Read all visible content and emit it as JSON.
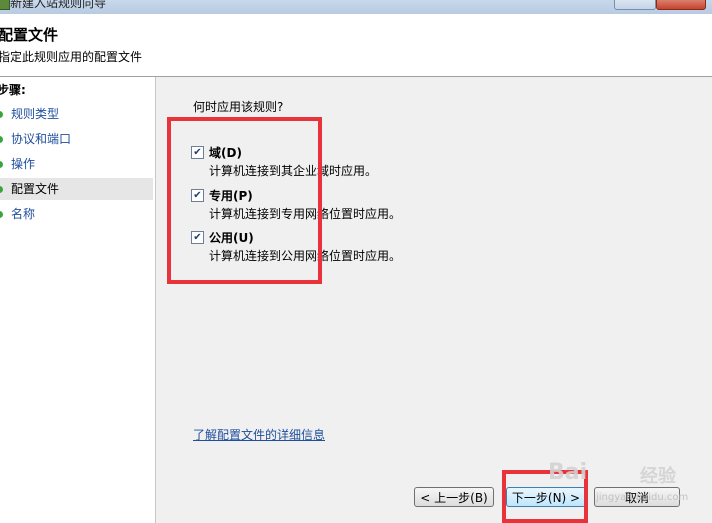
{
  "window": {
    "title": "新建入站规则向导"
  },
  "header": {
    "title": "配置文件",
    "subtitle": "指定此规则应用的配置文件"
  },
  "steps": {
    "title": "步骤:",
    "items": [
      {
        "label": "规则类型"
      },
      {
        "label": "协议和端口"
      },
      {
        "label": "操作"
      },
      {
        "label": "配置文件"
      },
      {
        "label": "名称"
      }
    ]
  },
  "main": {
    "question": "何时应用该规则?",
    "options": [
      {
        "label": "域(D)",
        "description": "计算机连接到其企业域时应用。",
        "checked": true
      },
      {
        "label": "专用(P)",
        "description": "计算机连接到专用网络位置时应用。",
        "checked": true
      },
      {
        "label": "公用(U)",
        "description": "计算机连接到公用网络位置时应用。",
        "checked": true
      }
    ],
    "learn_more": "了解配置文件的详细信息"
  },
  "buttons": {
    "back": "< 上一步(B)",
    "next": "下一步(N) >",
    "cancel": "取消"
  },
  "watermark": {
    "logo": "Bai",
    "text": "经验",
    "url": "jingyan.baidu.com"
  },
  "colors": {
    "highlight": "#e8333a",
    "link": "#1f4e9c",
    "step_dot": "#3aa53a"
  }
}
